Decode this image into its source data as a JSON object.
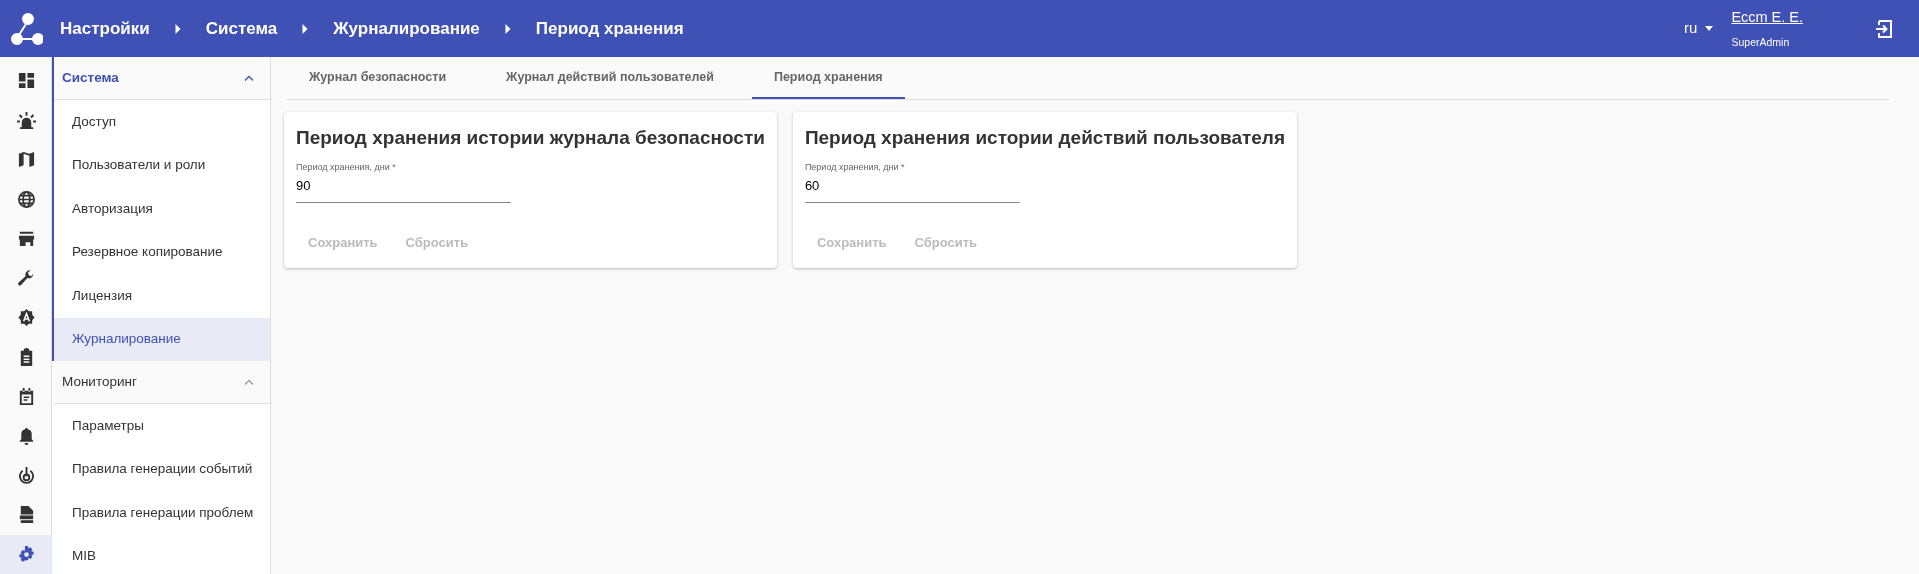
{
  "header": {
    "breadcrumbs": [
      "Настройки",
      "Система",
      "Журналирование",
      "Период хранения"
    ],
    "language": "ru",
    "user": {
      "name": "Ессm Е. Е.",
      "role": "SuperAdmin"
    }
  },
  "rail": [
    {
      "selected": false
    },
    {
      "selected": false
    },
    {
      "selected": false
    },
    {
      "selected": false
    },
    {
      "selected": false
    },
    {
      "selected": false
    },
    {
      "selected": false
    },
    {
      "selected": false
    },
    {
      "selected": false
    },
    {
      "selected": false
    },
    {
      "selected": false
    },
    {
      "selected": false
    },
    {
      "selected": true
    }
  ],
  "sidebar": {
    "groups": [
      {
        "label": "Система",
        "selected": true,
        "expanded": true,
        "items": [
          {
            "label": "Доступ",
            "selected": false
          },
          {
            "label": "Пользователи и роли",
            "selected": false
          },
          {
            "label": "Авторизация",
            "selected": false
          },
          {
            "label": "Резервное копирование",
            "selected": false
          },
          {
            "label": "Лицензия",
            "selected": false
          },
          {
            "label": "Журналирование",
            "selected": true
          }
        ]
      },
      {
        "label": "Мониторинг",
        "selected": false,
        "expanded": true,
        "items": [
          {
            "label": "Параметры",
            "selected": false
          },
          {
            "label": "Правила генерации событий",
            "selected": false
          },
          {
            "label": "Правила генерации проблем",
            "selected": false
          },
          {
            "label": "MIB",
            "selected": false
          }
        ]
      }
    ]
  },
  "tabs": [
    {
      "label": "Журнал безопасности",
      "selected": false
    },
    {
      "label": "Журнал действий пользователей",
      "selected": false
    },
    {
      "label": "Период хранения",
      "selected": true
    }
  ],
  "cards": [
    {
      "title": "Период хранения истории журнала безопасности",
      "field": {
        "label": "Период хранения, дни *",
        "value": "90"
      },
      "buttons": [
        {
          "label": "Сохранить",
          "disabled": true
        },
        {
          "label": "Сбросить",
          "disabled": true
        }
      ]
    },
    {
      "title": "Период хранения истории действий пользователя",
      "field": {
        "label": "Период хранения, дни *",
        "value": "60"
      },
      "buttons": [
        {
          "label": "Сохранить",
          "disabled": true
        },
        {
          "label": "Сбросить",
          "disabled": true
        }
      ]
    }
  ]
}
